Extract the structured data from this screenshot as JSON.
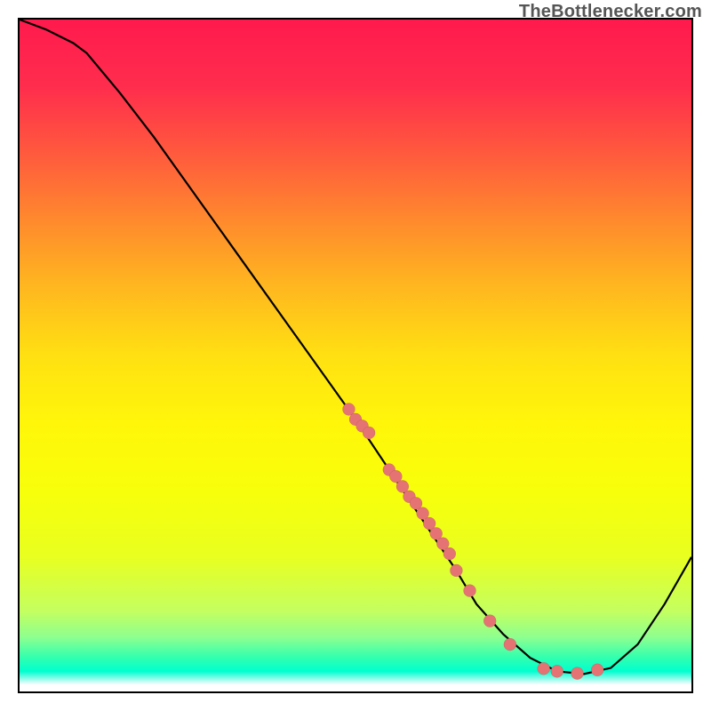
{
  "watermark": "TheBottlenecker.com",
  "chart_data": {
    "type": "line",
    "title": "",
    "xlabel": "",
    "ylabel": "",
    "xlim": [
      0,
      100
    ],
    "ylim": [
      0,
      100
    ],
    "curve": {
      "x": [
        0,
        4,
        8,
        10,
        15,
        20,
        25,
        30,
        35,
        40,
        45,
        50,
        55,
        60,
        65,
        68,
        72,
        76,
        80,
        84,
        88,
        92,
        96,
        100
      ],
      "y": [
        100,
        98.5,
        96.5,
        95,
        89,
        82.5,
        75.5,
        68.5,
        61.5,
        54.5,
        47.5,
        40.5,
        33,
        25.5,
        18,
        13,
        8.5,
        5,
        3,
        2.6,
        3.5,
        7,
        13,
        20
      ]
    },
    "markers": {
      "x": [
        49,
        50,
        51,
        52,
        55,
        56,
        57,
        58,
        59,
        60,
        61,
        62,
        63,
        64,
        65,
        67,
        70,
        73,
        78,
        80,
        83,
        86
      ],
      "y": [
        42,
        40.5,
        39.5,
        38.5,
        33,
        32,
        30.5,
        29,
        28,
        26.5,
        25,
        23.5,
        22,
        20.5,
        18,
        15,
        10.5,
        7,
        3.4,
        3,
        2.7,
        3.2
      ]
    },
    "marker_radius": 7
  }
}
